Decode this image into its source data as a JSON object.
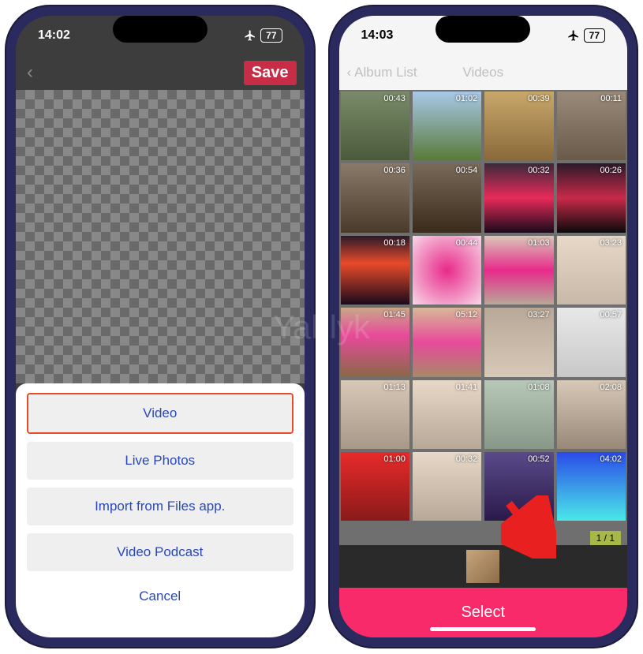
{
  "watermark": "Yablyk",
  "phone1": {
    "status": {
      "time": "14:02",
      "battery": "77"
    },
    "nav": {
      "save_label": "Save"
    },
    "sheet": {
      "options": [
        {
          "label": "Video",
          "highlighted": true
        },
        {
          "label": "Live Photos",
          "highlighted": false
        },
        {
          "label": "Import from Files app.",
          "highlighted": false
        },
        {
          "label": "Video Podcast",
          "highlighted": false
        }
      ],
      "cancel_label": "Cancel"
    }
  },
  "phone2": {
    "status": {
      "time": "14:03",
      "battery": "77"
    },
    "nav": {
      "back_label": "Album List",
      "title": "Videos"
    },
    "videos": [
      {
        "duration": "00:43"
      },
      {
        "duration": "01:02"
      },
      {
        "duration": "00:39"
      },
      {
        "duration": "00:11"
      },
      {
        "duration": "00:36"
      },
      {
        "duration": "00:54"
      },
      {
        "duration": "00:32"
      },
      {
        "duration": "00:26"
      },
      {
        "duration": "00:18"
      },
      {
        "duration": "00:44"
      },
      {
        "duration": "01:03"
      },
      {
        "duration": "03:23"
      },
      {
        "duration": "01:45"
      },
      {
        "duration": "05:12"
      },
      {
        "duration": "03:27"
      },
      {
        "duration": "00:57"
      },
      {
        "duration": "01:13"
      },
      {
        "duration": "01:41"
      },
      {
        "duration": "01:08"
      },
      {
        "duration": "02:08"
      },
      {
        "duration": "01:00"
      },
      {
        "duration": "00:32"
      },
      {
        "duration": "00:52"
      },
      {
        "duration": "04:02"
      }
    ],
    "selection": {
      "count_label": "1 / 1"
    },
    "select_button": "Select"
  }
}
